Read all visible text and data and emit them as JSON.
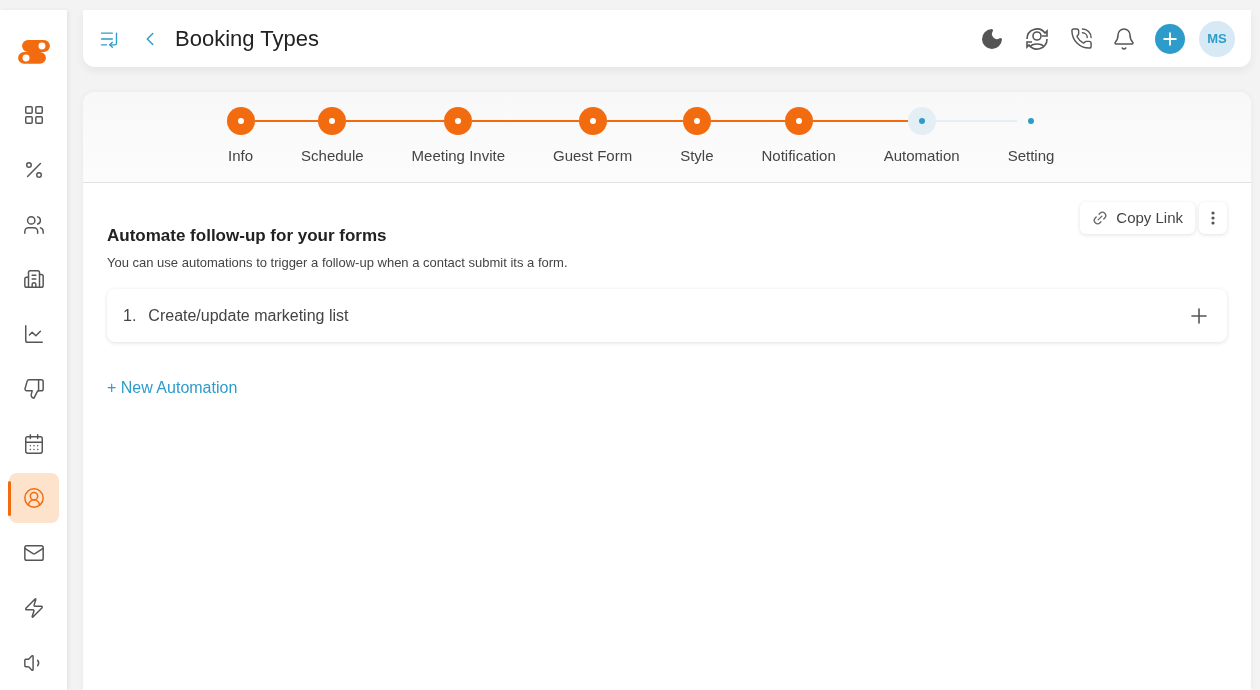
{
  "sidebar": {
    "items": [
      {
        "kind": "dashboard",
        "selected": false
      },
      {
        "kind": "deals",
        "selected": false
      },
      {
        "kind": "contacts",
        "selected": false
      },
      {
        "kind": "companies",
        "selected": false
      },
      {
        "kind": "reports",
        "selected": false
      },
      {
        "kind": "feedback",
        "selected": false
      },
      {
        "kind": "calendar",
        "selected": false
      },
      {
        "kind": "profile",
        "selected": true
      },
      {
        "kind": "mail",
        "selected": false
      },
      {
        "kind": "automation",
        "selected": false
      },
      {
        "kind": "campaigns",
        "selected": false
      }
    ]
  },
  "header": {
    "title": "Booking Types",
    "avatar": "MS"
  },
  "steps": [
    {
      "label": "Info",
      "kind": "done"
    },
    {
      "label": "Schedule",
      "kind": "done"
    },
    {
      "label": "Meeting Invite",
      "kind": "done"
    },
    {
      "label": "Guest Form",
      "kind": "done"
    },
    {
      "label": "Style",
      "kind": "done"
    },
    {
      "label": "Notification",
      "kind": "done"
    },
    {
      "label": "Automation",
      "kind": "current"
    },
    {
      "label": "Setting",
      "kind": "todo"
    }
  ],
  "section": {
    "title": "Automate follow-up for your forms",
    "description": "You can use automations to trigger a follow-up when a contact submit its a form.",
    "copy_link": "Copy Link"
  },
  "automations": [
    {
      "number": "1.",
      "label": "Create/update marketing list"
    }
  ],
  "new_automation": "+ New Automation"
}
